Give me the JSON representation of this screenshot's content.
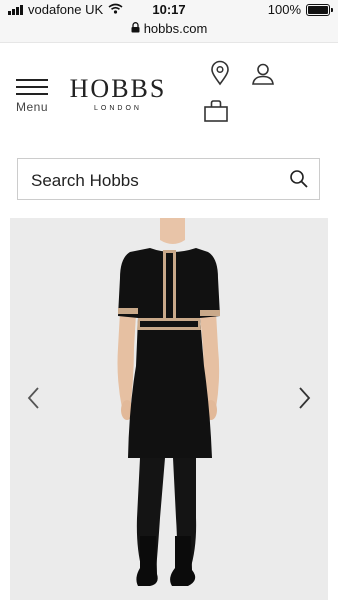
{
  "status_bar": {
    "carrier": "vodafone UK",
    "time": "10:17",
    "battery": "100%",
    "battery_level": 1.0
  },
  "address_bar": {
    "url": "hobbs.com"
  },
  "header": {
    "menu_label": "Menu",
    "logo_text": "HOBBS",
    "logo_subtext": "LONDON"
  },
  "search": {
    "placeholder": "Search Hobbs"
  },
  "icons": {
    "location": "map-pin-icon",
    "account": "user-icon",
    "bag": "shopping-bag-icon",
    "search": "search-icon",
    "prev": "chevron-left-icon",
    "next": "chevron-right-icon"
  },
  "colors": {
    "dress": "#111111",
    "trim": "#c9a98a",
    "carousel_bg": "#ebebeb"
  }
}
